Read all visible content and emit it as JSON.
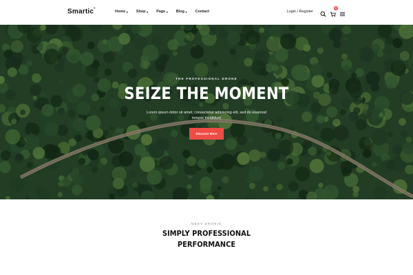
{
  "header": {
    "logo": "Smartic",
    "logo_mark": "°",
    "nav": [
      {
        "label": "Home",
        "has_dropdown": true
      },
      {
        "label": "Shop",
        "has_dropdown": true
      },
      {
        "label": "Page",
        "has_dropdown": true
      },
      {
        "label": "Blog",
        "has_dropdown": true
      },
      {
        "label": "Contact",
        "has_dropdown": false
      }
    ],
    "login_label": "Login / Register",
    "cart_count": "0",
    "icons": [
      "search-icon",
      "cart-icon",
      "menu-icon"
    ]
  },
  "hero": {
    "kicker": "THE PROFESSIONAL DRONE",
    "title": "SEIZE THE MOMENT",
    "subtitle": "Lorem ipsum dolor sit amet, consectetur adipiscing elit, sed do eiusmod tempor incididunt",
    "cta_label": "Discover More",
    "background": "aerial forest with winding road"
  },
  "section": {
    "kicker": "MEET DRONIK",
    "title_line1": "SIMPLY PROFESSIONAL",
    "title_line2": "PERFORMANCE"
  },
  "colors": {
    "accent": "#ef4c45",
    "text": "#111111",
    "forest_dark": "#1f3a22",
    "forest_light": "#4f7a3c"
  }
}
